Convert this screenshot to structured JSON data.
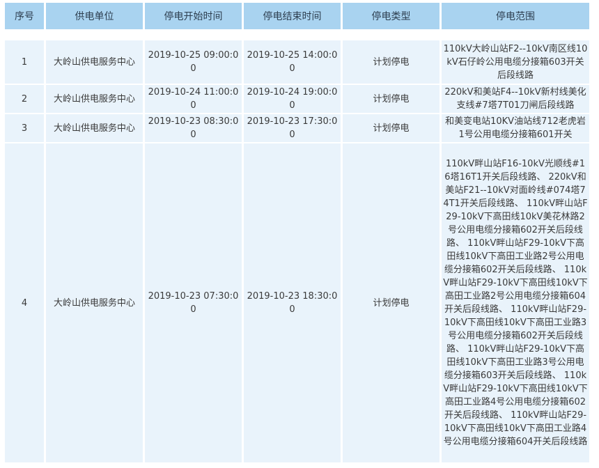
{
  "table": {
    "headers": [
      "序号",
      "供电单位",
      "停电开始时间",
      "停电结束时间",
      "停电类型",
      "停电范围"
    ],
    "rows": [
      {
        "no": "1",
        "unit": "大岭山供电服务中心",
        "start": "2019-10-25 09:00:00",
        "end": "2019-10-25 14:00:00",
        "type": "计划停电",
        "range": "110kV大岭山站F2--10kV南区线10kV石仔岭公用电缆分接箱603开关后段线路"
      },
      {
        "no": "2",
        "unit": "大岭山供电服务中心",
        "start": "2019-10-24 11:00:00",
        "end": "2019-10-24 19:00:00",
        "type": "计划停电",
        "range": "220kV和美站F4--10kV新村线美化支线#7塔7T01刀闸后段线路"
      },
      {
        "no": "3",
        "unit": "大岭山供电服务中心",
        "start": "2019-10-23 08:30:00",
        "end": "2019-10-23 17:30:00",
        "type": "计划停电",
        "range": "和美变电站10KV油站线712老虎岩1号公用电缆分接箱601开关"
      },
      {
        "no": "4",
        "unit": "大岭山供电服务中心",
        "start": "2019-10-23 07:30:00",
        "end": "2019-10-23 18:30:00",
        "type": "计划停电",
        "range": "110kV畔山站F16-10kV光顺线#16塔16T1开关后段线路、 220kV和美站F21--10kV对面岭线#074塔74T1开关后段线路、 110kV畔山站F29-10kV下高田线10kV美花林路2号公用电缆分接箱602开关后段线路、 110kV畔山站F29-10kV下高田线10kV下高田工业路2号公用电缆分接箱602开关后段线路、 110kV畔山站F29-10kV下高田线10kV下高田工业路2号公用电缆分接箱604开关后段线路、 110kV畔山站F29-10kV下高田线10kV下高田工业路3号公用电缆分接箱602开关后段线路、 110kV畔山站F29-10kV下高田线10kV下高田工业路3号公用电缆分接箱603开关后段线路、 110kV畔山站F29-10kV下高田线10kV下高田工业路4号公用电缆分接箱602开关后段线路、 110kV畔山站F29-10kV下高田线10kV下高田工业路4号公用电缆分接箱604开关后段线路"
      }
    ]
  },
  "colors": {
    "header_bg": "#a9d3f0",
    "row_bg": "#e9f3fb",
    "text": "#3a3a3a"
  }
}
